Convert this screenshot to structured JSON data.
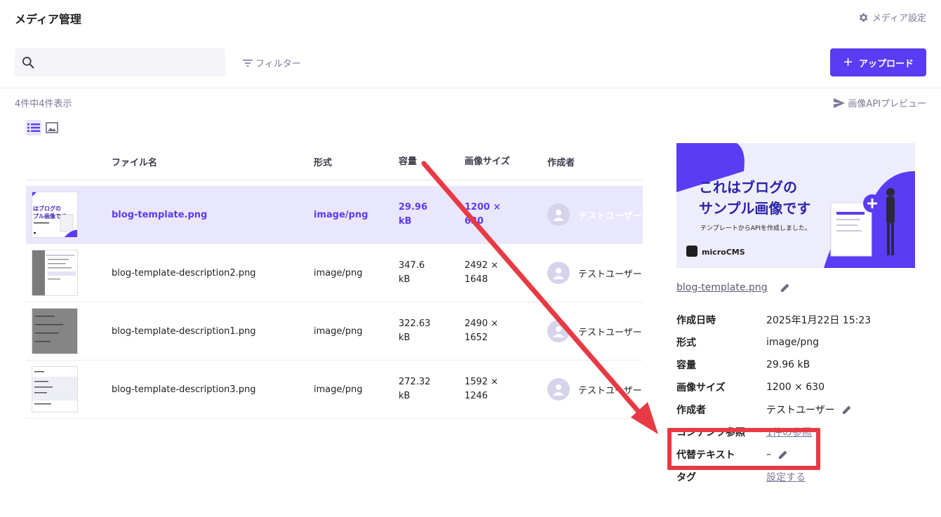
{
  "header": {
    "title": "メディア管理",
    "settings_label": "メディア設定"
  },
  "toolbar": {
    "search_placeholder": "",
    "filter_label": "フィルター",
    "upload_label": "アップロード"
  },
  "summary": {
    "count_text": "4件中4件表示",
    "api_preview_label": "画像APIプレビュー"
  },
  "table": {
    "columns": [
      "ファイル名",
      "形式",
      "容量",
      "画像サイズ",
      "作成者"
    ],
    "rows": [
      {
        "name": "blog-template.png",
        "type": "image/png",
        "size_value": "29.96",
        "size_unit": "kB",
        "dim_w": "1200 ×",
        "dim_h": "630",
        "author": "テストユーザー"
      },
      {
        "name": "blog-template-description2.png",
        "type": "image/png",
        "size_value": "347.6",
        "size_unit": "kB",
        "dim_w": "2492 ×",
        "dim_h": "1648",
        "author": "テストユーザー"
      },
      {
        "name": "blog-template-description1.png",
        "type": "image/png",
        "size_value": "322.63",
        "size_unit": "kB",
        "dim_w": "2490 ×",
        "dim_h": "1652",
        "author": "テストユーザー"
      },
      {
        "name": "blog-template-description3.png",
        "type": "image/png",
        "size_value": "272.32",
        "size_unit": "kB",
        "dim_w": "1592 ×",
        "dim_h": "1246",
        "author": "テストユーザー"
      }
    ]
  },
  "preview": {
    "headline_1": "これはブログの",
    "headline_2": "サンプル画像です",
    "subline": "テンプレートからAPIを作成しました。",
    "brand": "microCMS",
    "thumb_line_1": "はブログの",
    "thumb_line_2": "プル画像です"
  },
  "detail": {
    "filename": "blog-template.png",
    "rows": [
      {
        "label": "作成日時",
        "value": "2025年1月22日 15:23"
      },
      {
        "label": "形式",
        "value": "image/png"
      },
      {
        "label": "容量",
        "value": "29.96 kB"
      },
      {
        "label": "画像サイズ",
        "value": "1200 × 630"
      },
      {
        "label": "作成者",
        "value": "テストユーザー"
      },
      {
        "label": "コンテンツ参照",
        "value": "1件の参照"
      },
      {
        "label": "代替テキスト",
        "value": "–"
      },
      {
        "label": "タグ",
        "value": "設定する"
      }
    ]
  },
  "colors": {
    "accent": "#5a3cf5",
    "highlight": "#e83a44"
  }
}
